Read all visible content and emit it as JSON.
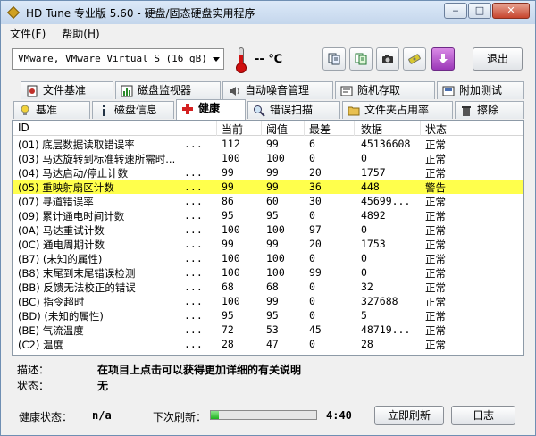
{
  "window": {
    "title": "HD Tune 专业版 5.60 - 硬盘/固态硬盘实用程序"
  },
  "menu": [
    {
      "label": "文件(F)"
    },
    {
      "label": "帮助(H)"
    }
  ],
  "toolbar": {
    "drive": "VMware, VMware Virtual S (16 gB)",
    "temperature": "-- ℃",
    "exit_label": "退出"
  },
  "tabs_top": [
    {
      "label": "文件基准"
    },
    {
      "label": "磁盘监视器"
    },
    {
      "label": "自动噪音管理"
    },
    {
      "label": "随机存取"
    },
    {
      "label": "附加测试"
    }
  ],
  "tabs_bottom": [
    {
      "label": "基准"
    },
    {
      "label": "磁盘信息"
    },
    {
      "label": "健康"
    },
    {
      "label": "错误扫描"
    },
    {
      "label": "文件夹占用率"
    },
    {
      "label": "擦除"
    }
  ],
  "table": {
    "headers": [
      "ID",
      "当前",
      "阈值",
      "最差",
      "数据",
      "状态"
    ],
    "rows": [
      {
        "id": "(01) 底层数据读取错误率",
        "dots": "...",
        "current": "112",
        "threshold": "99",
        "worst": "6",
        "data": "45136608",
        "status": "正常"
      },
      {
        "id": "(03) 马达旋转到标准转速所需时...",
        "dots": "",
        "current": "100",
        "threshold": "100",
        "worst": "0",
        "data": "0",
        "status": "正常"
      },
      {
        "id": "(04) 马达启动/停止计数",
        "dots": "...",
        "current": "99",
        "threshold": "99",
        "worst": "20",
        "data": "1757",
        "status": "正常"
      },
      {
        "id": "(05) 重映射扇区计数",
        "dots": "...",
        "current": "99",
        "threshold": "99",
        "worst": "36",
        "data": "448",
        "status": "警告"
      },
      {
        "id": "(07) 寻道错误率",
        "dots": "...",
        "current": "86",
        "threshold": "60",
        "worst": "30",
        "data": "45699...",
        "status": "正常"
      },
      {
        "id": "(09) 累计通电时间计数",
        "dots": "...",
        "current": "95",
        "threshold": "95",
        "worst": "0",
        "data": "4892",
        "status": "正常"
      },
      {
        "id": "(0A) 马达重试计数",
        "dots": "...",
        "current": "100",
        "threshold": "100",
        "worst": "97",
        "data": "0",
        "status": "正常"
      },
      {
        "id": "(0C) 通电周期计数",
        "dots": "...",
        "current": "99",
        "threshold": "99",
        "worst": "20",
        "data": "1753",
        "status": "正常"
      },
      {
        "id": "(B7) (未知的属性)",
        "dots": "...",
        "current": "100",
        "threshold": "100",
        "worst": "0",
        "data": "0",
        "status": "正常"
      },
      {
        "id": "(B8) 末尾到末尾错误检测",
        "dots": "...",
        "current": "100",
        "threshold": "100",
        "worst": "99",
        "data": "0",
        "status": "正常"
      },
      {
        "id": "(BB) 反馈无法校正的错误",
        "dots": "...",
        "current": "68",
        "threshold": "68",
        "worst": "0",
        "data": "32",
        "status": "正常"
      },
      {
        "id": "(BC) 指令超时",
        "dots": "...",
        "current": "100",
        "threshold": "99",
        "worst": "0",
        "data": "327688",
        "status": "正常"
      },
      {
        "id": "(BD) (未知的属性)",
        "dots": "...",
        "current": "95",
        "threshold": "95",
        "worst": "0",
        "data": "5",
        "status": "正常"
      },
      {
        "id": "(BE) 气流温度",
        "dots": "...",
        "current": "72",
        "threshold": "53",
        "worst": "45",
        "data": "48719...",
        "status": "正常"
      },
      {
        "id": "(C2) 温度",
        "dots": "...",
        "current": "28",
        "threshold": "47",
        "worst": "0",
        "data": "28",
        "status": "正常"
      }
    ]
  },
  "description": {
    "desc_label": "描述：",
    "desc_value": "在项目上点击可以获得更加详细的有关说明",
    "status_label": "状态：",
    "status_value": "无"
  },
  "bottom": {
    "health_label": "健康状态：",
    "health_value": "n/a",
    "refresh_label": "下次刷新：",
    "progress_fraction": 0.08,
    "countdown": "4:40",
    "refresh_now": "立即刷新",
    "log": "日志"
  },
  "colors": {
    "warning_row": "#ffff4c",
    "progress_green": "#1db31d"
  }
}
